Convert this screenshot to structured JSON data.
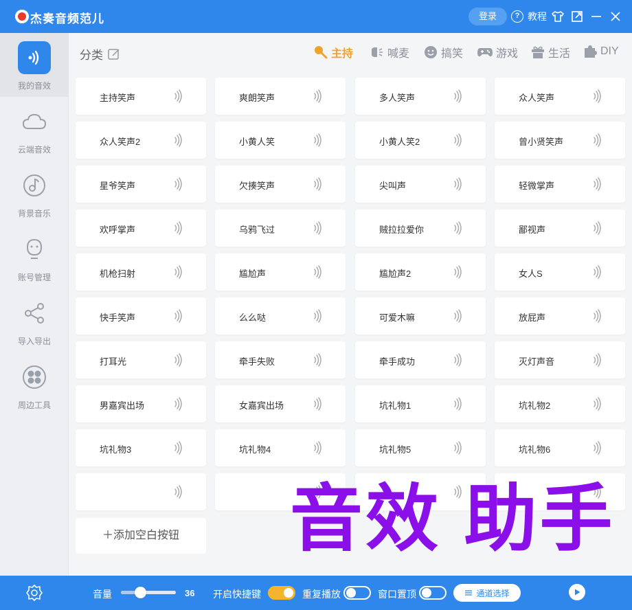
{
  "app": {
    "title": "杰奏音频范儿",
    "login_label": "登录",
    "help_label": "教程"
  },
  "sidebar": {
    "items": [
      {
        "label": "我的音效",
        "icon": "sound-wave-icon",
        "active": true
      },
      {
        "label": "云端音效",
        "icon": "cloud-icon",
        "active": false
      },
      {
        "label": "背景音乐",
        "icon": "music-disc-icon",
        "active": false
      },
      {
        "label": "账号管理",
        "icon": "face-icon",
        "active": false
      },
      {
        "label": "导入导出",
        "icon": "share-icon",
        "active": false
      },
      {
        "label": "周边工具",
        "icon": "clover-icon",
        "active": false
      }
    ]
  },
  "main": {
    "category_label": "分类",
    "tabs": [
      {
        "label": "主持",
        "icon": "mic-icon",
        "active": true
      },
      {
        "label": "喊麦",
        "icon": "megaphone-icon",
        "active": false
      },
      {
        "label": "搞笑",
        "icon": "smile-icon",
        "active": false
      },
      {
        "label": "游戏",
        "icon": "gamepad-icon",
        "active": false
      },
      {
        "label": "生活",
        "icon": "gift-icon",
        "active": false
      },
      {
        "label": "DIY",
        "icon": "puzzle-icon",
        "active": false
      }
    ],
    "buttons": [
      "主持笑声",
      "爽朗笑声",
      "多人笑声",
      "众人笑声",
      "众人笑声2",
      "小黄人笑",
      "小黄人笑2",
      "曾小贤笑声",
      "星爷笑声",
      "欠揍笑声",
      "尖叫声",
      "轻微掌声",
      "欢呼掌声",
      "乌鸦飞过",
      "贼拉拉爱你",
      "鄙视声",
      "机枪扫射",
      "尴尬声",
      "尴尬声2",
      "女人S",
      "快手笑声",
      "么么哒",
      "可爱木嘛",
      "放屁声",
      "打耳光",
      "牵手失败",
      "牵手成功",
      "灭灯声音",
      "男嘉宾出场",
      "女嘉宾出场",
      "坑礼物1",
      "坑礼物2",
      "坑礼物3",
      "坑礼物4",
      "坑礼物5",
      "坑礼物6",
      "",
      "",
      "",
      ""
    ],
    "add_button_label": "＋添加空白按钮",
    "watermark": "音效 助手"
  },
  "bottom": {
    "volume_label": "音量",
    "volume_value": "36",
    "volume_fraction": 0.36,
    "hotkey_label": "开启快捷键",
    "hotkey_on": true,
    "repeat_label": "重复播放",
    "repeat_on": false,
    "ontop_label": "窗口置顶",
    "ontop_on": false,
    "channel_label": "通道选择"
  },
  "colors": {
    "primary": "#2f87ec",
    "accent": "#f0a32c",
    "watermark": "#8b0fe8"
  }
}
